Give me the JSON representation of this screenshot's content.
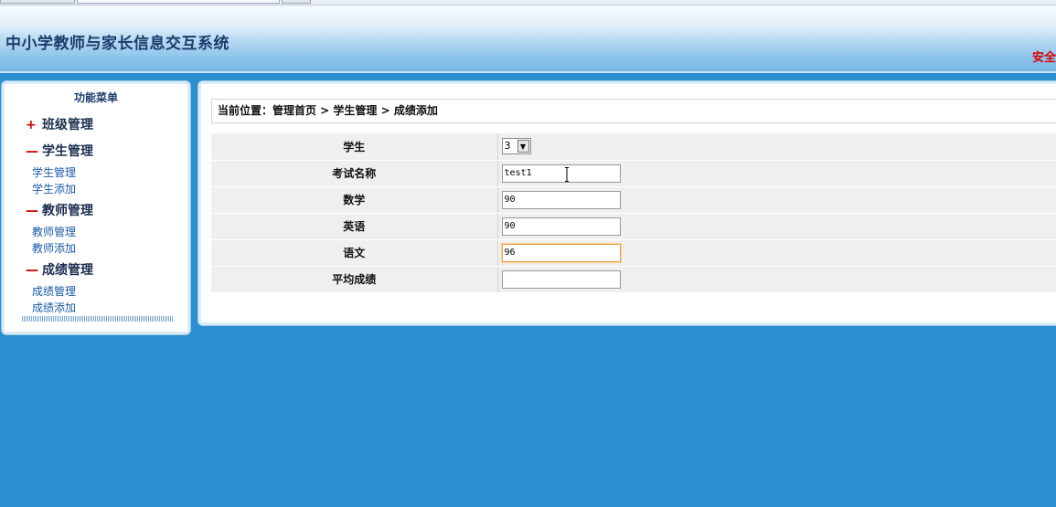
{
  "header": {
    "title": "中小学教师与家长信息交互系统",
    "safe_text": "安全"
  },
  "menu": {
    "title": "功能菜单",
    "groups": [
      {
        "sign": "+",
        "label": "班级管理",
        "items": []
      },
      {
        "sign": "—",
        "label": "学生管理",
        "items": [
          "学生管理",
          "学生添加"
        ]
      },
      {
        "sign": "—",
        "label": "教师管理",
        "items": [
          "教师管理",
          "教师添加"
        ]
      },
      {
        "sign": "—",
        "label": "成绩管理",
        "items": [
          "成绩管理",
          "成绩添加"
        ]
      }
    ]
  },
  "breadcrumb": "当前位置：管理首页 > 学生管理 > 成绩添加",
  "form": {
    "student": {
      "label": "学生",
      "value": "3"
    },
    "exam_name": {
      "label": "考试名称",
      "value": "test1"
    },
    "math": {
      "label": "数学",
      "value": "90"
    },
    "english": {
      "label": "英语",
      "value": "90"
    },
    "chinese": {
      "label": "语文",
      "value": "96"
    },
    "average": {
      "label": "平均成绩",
      "value": ""
    }
  }
}
